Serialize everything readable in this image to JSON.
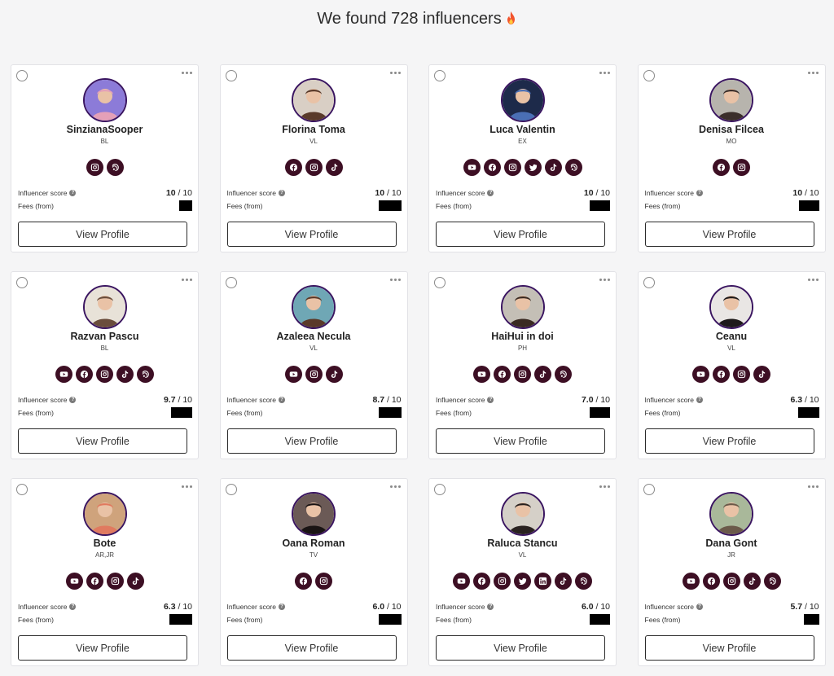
{
  "header": {
    "title": "We found 728 influencers"
  },
  "colors": {
    "social_bg": "#3d0f24",
    "avatar_ring": "#3a1560"
  },
  "labels": {
    "score": "Influencer score",
    "fees": "Fees (from)",
    "view": "View Profile"
  },
  "influencers": [
    {
      "name": "SinzianaSooper",
      "region": "BL",
      "socials": [
        "instagram-icon",
        "podcast-icon"
      ],
      "score": "10",
      "max": " / 10",
      "fee_redact_w": 16,
      "avatar_bg": "#8c7bd8",
      "avatar_fg": "#e4a0b8"
    },
    {
      "name": "Florina Toma",
      "region": "VL",
      "socials": [
        "facebook-icon",
        "instagram-icon",
        "tiktok-icon"
      ],
      "score": "10",
      "max": " / 10",
      "fee_redact_w": 28,
      "avatar_bg": "#d9cfc5",
      "avatar_fg": "#5a3a2a"
    },
    {
      "name": "Luca Valentin",
      "region": "EX",
      "socials": [
        "youtube-icon",
        "facebook-icon",
        "instagram-icon",
        "twitter-icon",
        "tiktok-icon",
        "podcast-icon"
      ],
      "score": "10",
      "max": " / 10",
      "fee_redact_w": 25,
      "avatar_bg": "#1d2a4a",
      "avatar_fg": "#4a6fb5"
    },
    {
      "name": "Denisa Filcea",
      "region": "MO",
      "socials": [
        "facebook-icon",
        "instagram-icon"
      ],
      "score": "10",
      "max": " / 10",
      "fee_redact_w": 25,
      "avatar_bg": "#b7b4ad",
      "avatar_fg": "#3b2e2a"
    },
    {
      "name": "Razvan Pascu",
      "region": "BL",
      "socials": [
        "youtube-icon",
        "facebook-icon",
        "instagram-icon",
        "tiktok-icon",
        "podcast-icon"
      ],
      "score": "9.7",
      "max": " / 10",
      "fee_redact_w": 26,
      "avatar_bg": "#e8e2d8",
      "avatar_fg": "#6a4d3c"
    },
    {
      "name": "Azaleea Necula",
      "region": "VL",
      "socials": [
        "youtube-icon",
        "instagram-icon",
        "tiktok-icon"
      ],
      "score": "8.7",
      "max": " / 10",
      "fee_redact_w": 28,
      "avatar_bg": "#6fa7b5",
      "avatar_fg": "#5a3a2a"
    },
    {
      "name": "HaiHui in doi",
      "region": "PH",
      "socials": [
        "youtube-icon",
        "facebook-icon",
        "instagram-icon",
        "tiktok-icon",
        "podcast-icon"
      ],
      "score": "7.0",
      "max": " / 10",
      "fee_redact_w": 25,
      "avatar_bg": "#c4bfb6",
      "avatar_fg": "#3a2a22"
    },
    {
      "name": "Ceanu",
      "region": "VL",
      "socials": [
        "youtube-icon",
        "facebook-icon",
        "instagram-icon",
        "tiktok-icon"
      ],
      "score": "6.3",
      "max": " / 10",
      "fee_redact_w": 26,
      "avatar_bg": "#e9e6e4",
      "avatar_fg": "#1e1a1a"
    },
    {
      "name": "Bote",
      "region": "AR,JR",
      "socials": [
        "youtube-icon",
        "facebook-icon",
        "instagram-icon",
        "tiktok-icon"
      ],
      "score": "6.3",
      "max": " / 10",
      "fee_redact_w": 28,
      "avatar_bg": "#cfa37c",
      "avatar_fg": "#e07a5f"
    },
    {
      "name": "Oana Roman",
      "region": "TV",
      "socials": [
        "facebook-icon",
        "instagram-icon"
      ],
      "score": "6.0",
      "max": " / 10",
      "fee_redact_w": 28,
      "avatar_bg": "#6b5a56",
      "avatar_fg": "#1a1414"
    },
    {
      "name": "Raluca Stancu",
      "region": "VL",
      "socials": [
        "youtube-icon",
        "facebook-icon",
        "instagram-icon",
        "twitter-icon",
        "linkedin-icon",
        "tiktok-icon",
        "podcast-icon"
      ],
      "score": "6.0",
      "max": " / 10",
      "fee_redact_w": 25,
      "avatar_bg": "#d5d0c8",
      "avatar_fg": "#2a2220"
    },
    {
      "name": "Dana Gont",
      "region": "JR",
      "socials": [
        "youtube-icon",
        "facebook-icon",
        "instagram-icon",
        "tiktok-icon",
        "podcast-icon"
      ],
      "score": "5.7",
      "max": " / 10",
      "fee_redact_w": 19,
      "avatar_bg": "#a9b89a",
      "avatar_fg": "#6b5a4a"
    }
  ]
}
